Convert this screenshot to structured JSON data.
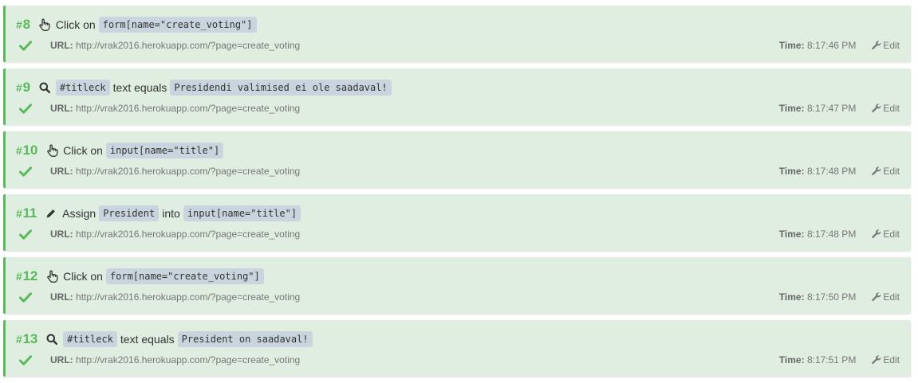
{
  "steps": [
    {
      "number": "8",
      "icon": "pointer-hand-icon",
      "parts": [
        {
          "kind": "text",
          "value": "Click on"
        },
        {
          "kind": "code",
          "value": "form[name=\"create_voting\"]"
        }
      ],
      "url_label": "URL:",
      "url": "http://vrak2016.herokuapp.com/?page=create_voting",
      "time_label": "Time:",
      "time": "8:17:46 PM",
      "edit_label": "Edit"
    },
    {
      "number": "9",
      "icon": "search-icon",
      "parts": [
        {
          "kind": "code",
          "value": "#titleck"
        },
        {
          "kind": "text",
          "value": "text equals"
        },
        {
          "kind": "code",
          "value": "Presidendi valimised ei ole saadaval!"
        }
      ],
      "url_label": "URL:",
      "url": "http://vrak2016.herokuapp.com/?page=create_voting",
      "time_label": "Time:",
      "time": "8:17:47 PM",
      "edit_label": "Edit"
    },
    {
      "number": "10",
      "icon": "pointer-hand-icon",
      "parts": [
        {
          "kind": "text",
          "value": "Click on"
        },
        {
          "kind": "code",
          "value": "input[name=\"title\"]"
        }
      ],
      "url_label": "URL:",
      "url": "http://vrak2016.herokuapp.com/?page=create_voting",
      "time_label": "Time:",
      "time": "8:17:48 PM",
      "edit_label": "Edit"
    },
    {
      "number": "11",
      "icon": "pencil-icon",
      "parts": [
        {
          "kind": "text",
          "value": "Assign"
        },
        {
          "kind": "code",
          "value": "President"
        },
        {
          "kind": "text",
          "value": "into"
        },
        {
          "kind": "code",
          "value": "input[name=\"title\"]"
        }
      ],
      "url_label": "URL:",
      "url": "http://vrak2016.herokuapp.com/?page=create_voting",
      "time_label": "Time:",
      "time": "8:17:48 PM",
      "edit_label": "Edit"
    },
    {
      "number": "12",
      "icon": "pointer-hand-icon",
      "parts": [
        {
          "kind": "text",
          "value": "Click on"
        },
        {
          "kind": "code",
          "value": "form[name=\"create_voting\"]"
        }
      ],
      "url_label": "URL:",
      "url": "http://vrak2016.herokuapp.com/?page=create_voting",
      "time_label": "Time:",
      "time": "8:17:50 PM",
      "edit_label": "Edit"
    },
    {
      "number": "13",
      "icon": "search-icon",
      "parts": [
        {
          "kind": "code",
          "value": "#titleck"
        },
        {
          "kind": "text",
          "value": "text equals"
        },
        {
          "kind": "code",
          "value": "President on saadaval!"
        }
      ],
      "url_label": "URL:",
      "url": "http://vrak2016.herokuapp.com/?page=create_voting",
      "time_label": "Time:",
      "time": "8:17:51 PM",
      "edit_label": "Edit"
    }
  ],
  "colors": {
    "success_green": "#5cb85c",
    "card_background": "#dfeee0",
    "code_background": "#c8d5de"
  }
}
